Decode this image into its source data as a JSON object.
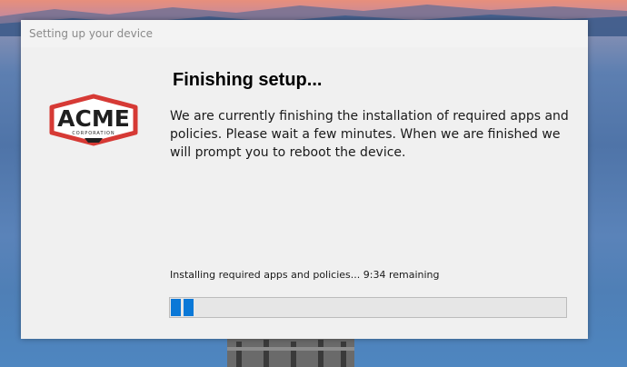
{
  "window": {
    "title": "Setting up your device"
  },
  "logo": {
    "text": "ACME",
    "subtext": "CORPORATION"
  },
  "content": {
    "heading": "Finishing setup...",
    "message": "We are currently finishing the installation of required apps and policies. Please wait a few minutes. When we are finished we will prompt you to reboot the device.",
    "status": "Installing required apps and policies... 9:34 remaining"
  },
  "progress": {
    "fraction": 0.06,
    "color": "#0a78d7"
  },
  "colors": {
    "logo_red": "#d63a35",
    "logo_dark": "#1f1f1f"
  }
}
